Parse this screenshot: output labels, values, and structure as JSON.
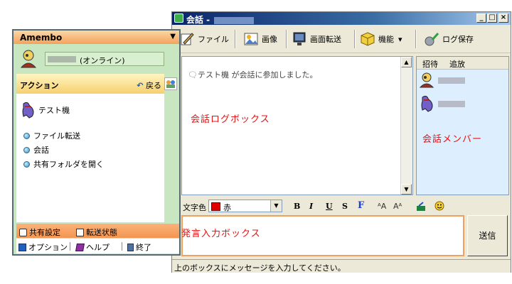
{
  "chat": {
    "title": "会話 -",
    "toolbar": {
      "file": "ファイル",
      "image": "画像",
      "screen_transfer": "画面転送",
      "function": "機能",
      "function_arrow": "▾",
      "save_log": "ログ保存"
    },
    "log_message": "テスト機 が会話に参加しました。",
    "members_tabs": {
      "invite": "招待",
      "kick": "追放"
    },
    "format": {
      "color_label": "文字色",
      "color_value": "赤",
      "color_hex": "#e00000",
      "bold": "B",
      "italic": "I",
      "underline": "U",
      "strike": "S",
      "font": "F"
    },
    "send_button": "送信",
    "status": "上のボックスにメッセージを入力してください。",
    "annotations": {
      "log_box": "会話ログボックス",
      "members_box": "会話メンバー",
      "input_box": "発言入力ボックス"
    }
  },
  "amembo": {
    "title": "Amembo",
    "dropdown": "▼",
    "user_status": "(オンライン)",
    "action_header": "アクション",
    "back": "戻る",
    "contact_name": "テスト機",
    "actions": [
      "ファイル転送",
      "会話",
      "共有フォルダを開く"
    ],
    "footer1": {
      "share_settings": "共有設定",
      "transfer_status": "転送状態"
    },
    "footer2": {
      "options": "オプション",
      "help": "ヘルプ",
      "exit": "終了"
    }
  }
}
